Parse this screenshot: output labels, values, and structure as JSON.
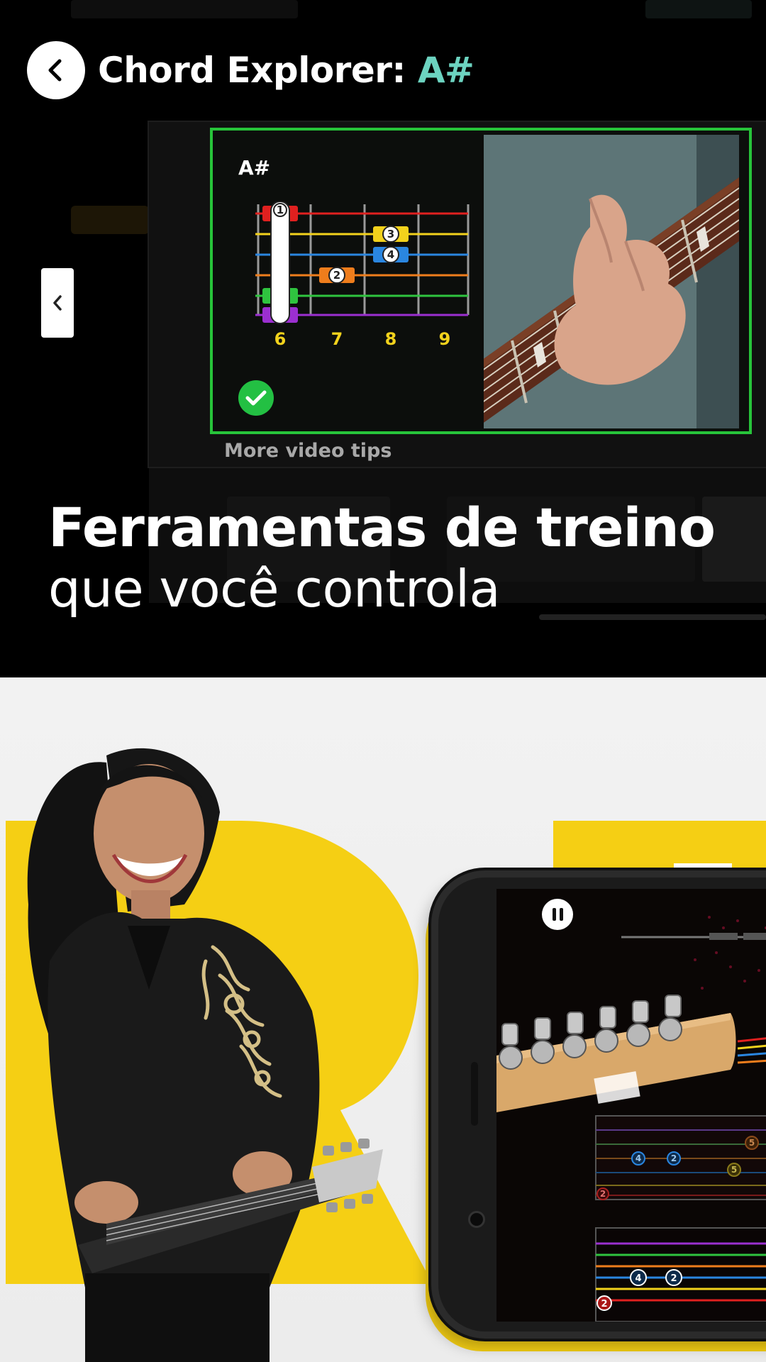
{
  "header": {
    "title_prefix": "Chord Explorer: ",
    "title_chord": "A#"
  },
  "chord_card": {
    "chord_name": "A#",
    "fret_numbers": [
      "6",
      "7",
      "8",
      "9"
    ],
    "finger_labels": [
      "1",
      "2",
      "3",
      "4"
    ],
    "string_colors": [
      "#e0201f",
      "#f2d21c",
      "#2a86e0",
      "#ef7d1c",
      "#2fc43f",
      "#9b2fd0"
    ]
  },
  "more_video_tips": "More video tips",
  "headline": {
    "line1": "Ferramentas de treino",
    "line2": "que você controla"
  },
  "colors": {
    "accent_teal": "#6cd3c0",
    "card_border_green": "#27c43a",
    "brand_yellow": "#f5cf14"
  },
  "icons": {
    "back": "chevron-left-icon",
    "prev": "chevron-left-icon",
    "check": "check-icon",
    "pause": "pause-icon"
  },
  "phone_tab": {
    "finger_labels": [
      "2",
      "4",
      "2",
      "5",
      "5"
    ]
  }
}
